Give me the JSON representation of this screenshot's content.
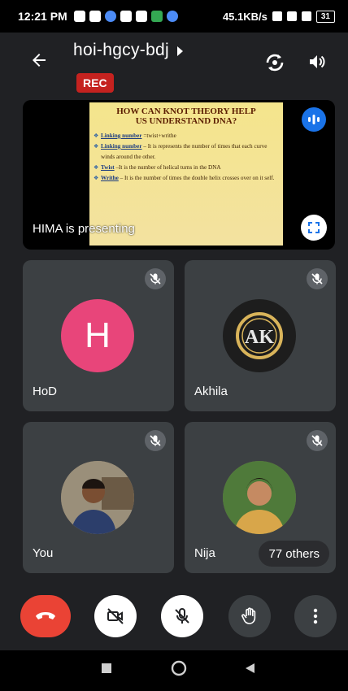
{
  "status_bar": {
    "time": "12:21 PM",
    "net_speed": "45.1KB/s",
    "battery": "31"
  },
  "meeting": {
    "code": "hoi-hgcy-bdj",
    "rec_label": "REC"
  },
  "presentation": {
    "presenter_label": "HIMA is presenting",
    "slide": {
      "title_line1": "HOW CAN KNOT THEORY HELP",
      "title_line2": "US UNDERSTAND DNA?",
      "bullets": [
        {
          "term": "Linking number",
          "text": " =twist+writhe"
        },
        {
          "term": "Linking number",
          "text": " – It is represents the number of times that each curve winds around the other."
        },
        {
          "term": "Twist",
          "text": " –It is the number of helical turns in the DNA"
        },
        {
          "term": "Writhe",
          "text": " – It is the number of times the double helix crosses over on it self."
        }
      ]
    }
  },
  "participants": [
    {
      "name": "HoD",
      "initial": "H"
    },
    {
      "name": "Akhila",
      "logo_text": "AK"
    },
    {
      "name": "You"
    },
    {
      "name": "Nija"
    }
  ],
  "others_label": "77 others",
  "colors": {
    "background": "#202124",
    "tile": "#3c4043",
    "accent_blue": "#1a73e8",
    "end_call_red": "#ea4335",
    "rec_red": "#c5221f",
    "avatar_pink": "#e8457a"
  }
}
